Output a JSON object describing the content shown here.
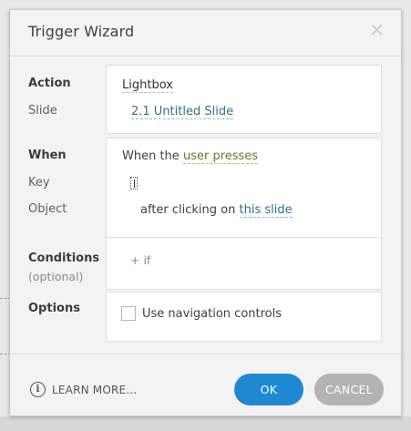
{
  "dialog": {
    "title": "Trigger Wizard",
    "close_glyph": "×"
  },
  "action": {
    "label": "Action",
    "value": "Lightbox",
    "slide_label": "Slide",
    "slide_value": "2.1 Untitled Slide"
  },
  "when": {
    "label": "When",
    "prefix": "When the",
    "event": "user presses",
    "key_label": "Key",
    "object_label": "Object",
    "object_prefix": "after clicking on",
    "object_value": "this slide"
  },
  "conditions": {
    "label": "Conditions",
    "optional": "(optional)",
    "add_if": "+ if"
  },
  "options": {
    "label": "Options",
    "checkbox_label": "Use navigation controls",
    "checked": false
  },
  "footer": {
    "info_icon": "info-circle-icon",
    "info_glyph": "i",
    "learn_more": "LEARN MORE...",
    "ok": "OK",
    "cancel": "CANCEL"
  },
  "colors": {
    "ok_button": "#1f88d3",
    "cancel_button": "#b3b3b3",
    "link": "#2f6f8c",
    "event_link": "#5f7d2c"
  }
}
